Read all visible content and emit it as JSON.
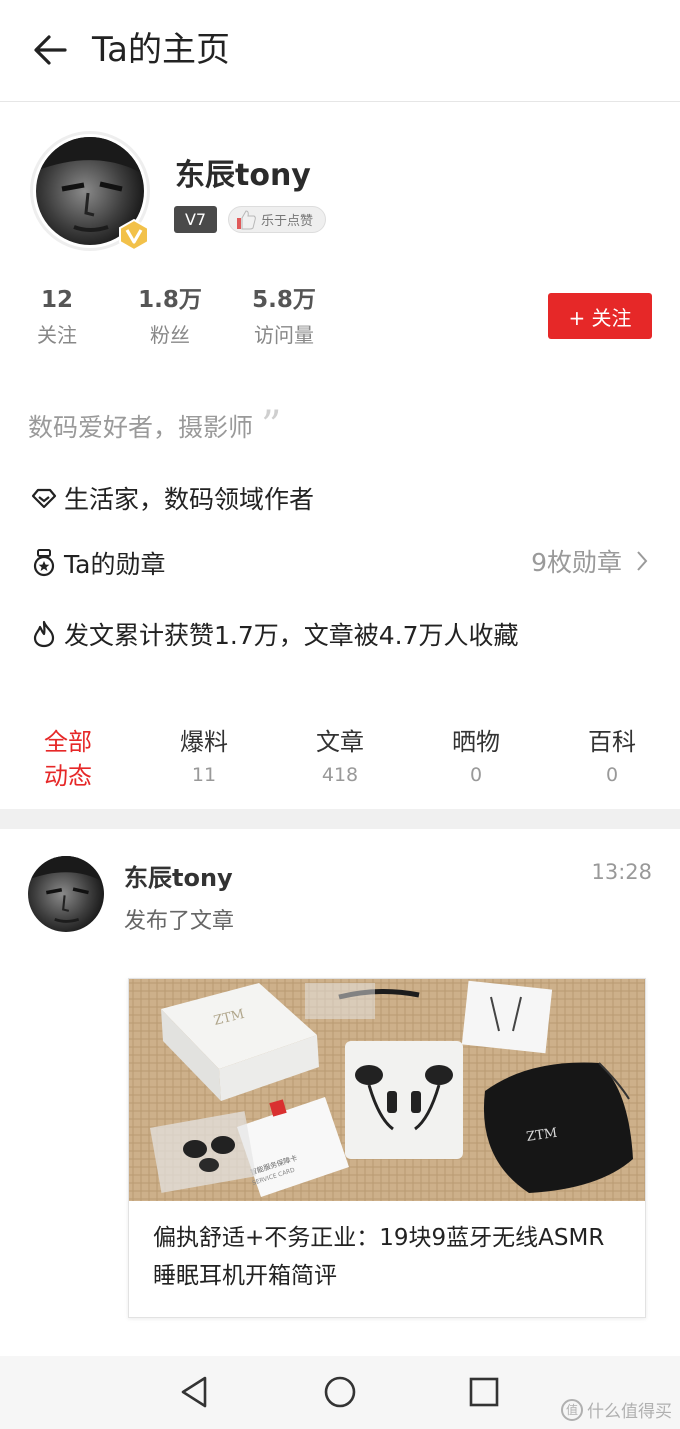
{
  "header": {
    "title": "Ta的主页",
    "back_icon": "arrow-left-icon"
  },
  "profile": {
    "username": "东辰tony",
    "level": "V7",
    "tag": "乐于点赞",
    "stats": [
      {
        "num": "12",
        "label": "关注"
      },
      {
        "num": "1.8万",
        "label": "粉丝"
      },
      {
        "num": "5.8万",
        "label": "访问量"
      }
    ],
    "follow_label": "+ 关注",
    "bio": "数码爱好者，摄影师",
    "title_line": "生活家，数码领域作者",
    "medal_label": "Ta的勋章",
    "medal_count": "9枚勋章",
    "stats_line": "发文累计获赞1.7万，文章被4.7万人收藏"
  },
  "tabs": [
    {
      "label_1": "全部",
      "label_2": "动态",
      "active": true
    },
    {
      "label": "爆料",
      "count": "11"
    },
    {
      "label": "文章",
      "count": "418"
    },
    {
      "label": "晒物",
      "count": "0"
    },
    {
      "label": "百科",
      "count": "0"
    }
  ],
  "feed": {
    "name": "东辰tony",
    "time": "13:28",
    "action": "发布了文章",
    "card_title": "偏执舒适+不务正业：19块9蓝牙无线ASMR睡眠耳机开箱简评",
    "image_text": {
      "box_logo": "ZTM",
      "pouch_logo": "ZTM",
      "card_text_1": "智能服务保障卡",
      "card_text_2": "SERVICE CARD"
    }
  },
  "watermark": "什么值得买",
  "colors": {
    "accent": "#e62828",
    "text": "#222222",
    "muted": "#999999",
    "divider": "#f0f0f0"
  }
}
